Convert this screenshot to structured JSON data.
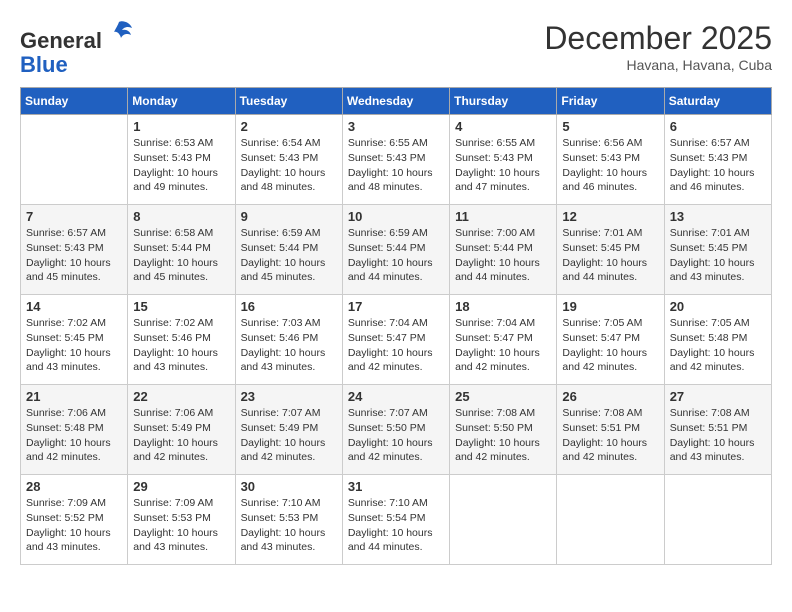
{
  "header": {
    "logo_line1": "General",
    "logo_line2": "Blue",
    "month": "December 2025",
    "location": "Havana, Havana, Cuba"
  },
  "weekdays": [
    "Sunday",
    "Monday",
    "Tuesday",
    "Wednesday",
    "Thursday",
    "Friday",
    "Saturday"
  ],
  "weeks": [
    [
      {
        "day": "",
        "info": ""
      },
      {
        "day": "1",
        "info": "Sunrise: 6:53 AM\nSunset: 5:43 PM\nDaylight: 10 hours\nand 49 minutes."
      },
      {
        "day": "2",
        "info": "Sunrise: 6:54 AM\nSunset: 5:43 PM\nDaylight: 10 hours\nand 48 minutes."
      },
      {
        "day": "3",
        "info": "Sunrise: 6:55 AM\nSunset: 5:43 PM\nDaylight: 10 hours\nand 48 minutes."
      },
      {
        "day": "4",
        "info": "Sunrise: 6:55 AM\nSunset: 5:43 PM\nDaylight: 10 hours\nand 47 minutes."
      },
      {
        "day": "5",
        "info": "Sunrise: 6:56 AM\nSunset: 5:43 PM\nDaylight: 10 hours\nand 46 minutes."
      },
      {
        "day": "6",
        "info": "Sunrise: 6:57 AM\nSunset: 5:43 PM\nDaylight: 10 hours\nand 46 minutes."
      }
    ],
    [
      {
        "day": "7",
        "info": "Sunrise: 6:57 AM\nSunset: 5:43 PM\nDaylight: 10 hours\nand 45 minutes."
      },
      {
        "day": "8",
        "info": "Sunrise: 6:58 AM\nSunset: 5:44 PM\nDaylight: 10 hours\nand 45 minutes."
      },
      {
        "day": "9",
        "info": "Sunrise: 6:59 AM\nSunset: 5:44 PM\nDaylight: 10 hours\nand 45 minutes."
      },
      {
        "day": "10",
        "info": "Sunrise: 6:59 AM\nSunset: 5:44 PM\nDaylight: 10 hours\nand 44 minutes."
      },
      {
        "day": "11",
        "info": "Sunrise: 7:00 AM\nSunset: 5:44 PM\nDaylight: 10 hours\nand 44 minutes."
      },
      {
        "day": "12",
        "info": "Sunrise: 7:01 AM\nSunset: 5:45 PM\nDaylight: 10 hours\nand 44 minutes."
      },
      {
        "day": "13",
        "info": "Sunrise: 7:01 AM\nSunset: 5:45 PM\nDaylight: 10 hours\nand 43 minutes."
      }
    ],
    [
      {
        "day": "14",
        "info": "Sunrise: 7:02 AM\nSunset: 5:45 PM\nDaylight: 10 hours\nand 43 minutes."
      },
      {
        "day": "15",
        "info": "Sunrise: 7:02 AM\nSunset: 5:46 PM\nDaylight: 10 hours\nand 43 minutes."
      },
      {
        "day": "16",
        "info": "Sunrise: 7:03 AM\nSunset: 5:46 PM\nDaylight: 10 hours\nand 43 minutes."
      },
      {
        "day": "17",
        "info": "Sunrise: 7:04 AM\nSunset: 5:47 PM\nDaylight: 10 hours\nand 42 minutes."
      },
      {
        "day": "18",
        "info": "Sunrise: 7:04 AM\nSunset: 5:47 PM\nDaylight: 10 hours\nand 42 minutes."
      },
      {
        "day": "19",
        "info": "Sunrise: 7:05 AM\nSunset: 5:47 PM\nDaylight: 10 hours\nand 42 minutes."
      },
      {
        "day": "20",
        "info": "Sunrise: 7:05 AM\nSunset: 5:48 PM\nDaylight: 10 hours\nand 42 minutes."
      }
    ],
    [
      {
        "day": "21",
        "info": "Sunrise: 7:06 AM\nSunset: 5:48 PM\nDaylight: 10 hours\nand 42 minutes."
      },
      {
        "day": "22",
        "info": "Sunrise: 7:06 AM\nSunset: 5:49 PM\nDaylight: 10 hours\nand 42 minutes."
      },
      {
        "day": "23",
        "info": "Sunrise: 7:07 AM\nSunset: 5:49 PM\nDaylight: 10 hours\nand 42 minutes."
      },
      {
        "day": "24",
        "info": "Sunrise: 7:07 AM\nSunset: 5:50 PM\nDaylight: 10 hours\nand 42 minutes."
      },
      {
        "day": "25",
        "info": "Sunrise: 7:08 AM\nSunset: 5:50 PM\nDaylight: 10 hours\nand 42 minutes."
      },
      {
        "day": "26",
        "info": "Sunrise: 7:08 AM\nSunset: 5:51 PM\nDaylight: 10 hours\nand 42 minutes."
      },
      {
        "day": "27",
        "info": "Sunrise: 7:08 AM\nSunset: 5:51 PM\nDaylight: 10 hours\nand 43 minutes."
      }
    ],
    [
      {
        "day": "28",
        "info": "Sunrise: 7:09 AM\nSunset: 5:52 PM\nDaylight: 10 hours\nand 43 minutes."
      },
      {
        "day": "29",
        "info": "Sunrise: 7:09 AM\nSunset: 5:53 PM\nDaylight: 10 hours\nand 43 minutes."
      },
      {
        "day": "30",
        "info": "Sunrise: 7:10 AM\nSunset: 5:53 PM\nDaylight: 10 hours\nand 43 minutes."
      },
      {
        "day": "31",
        "info": "Sunrise: 7:10 AM\nSunset: 5:54 PM\nDaylight: 10 hours\nand 44 minutes."
      },
      {
        "day": "",
        "info": ""
      },
      {
        "day": "",
        "info": ""
      },
      {
        "day": "",
        "info": ""
      }
    ]
  ]
}
